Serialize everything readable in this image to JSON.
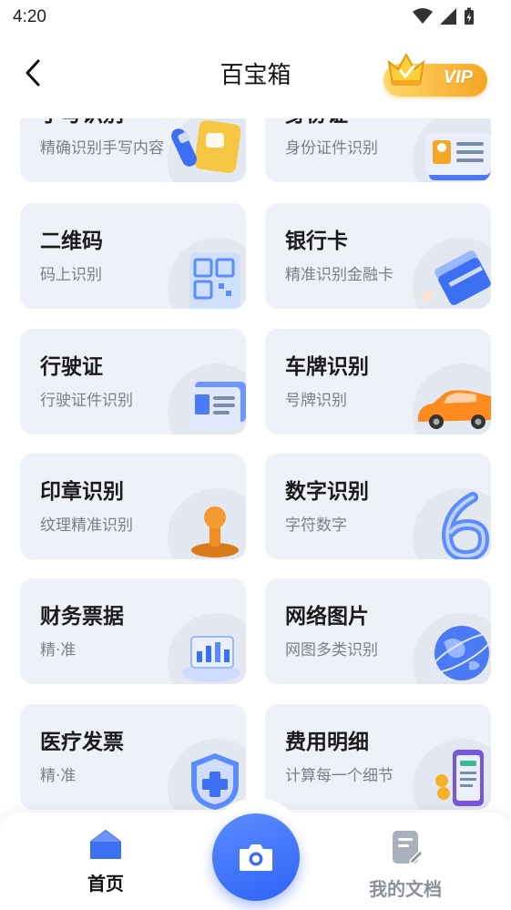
{
  "status_bar": {
    "time": "4:20"
  },
  "header": {
    "title": "百宝箱",
    "vip_label": "VIP",
    "back_icon": "chevron-left-icon"
  },
  "colors": {
    "accent": "#2f63f5",
    "card_bg": "#eef1f7",
    "vip_gold": "#f5a623"
  },
  "cards": [
    {
      "title": "手写识别",
      "subtitle": "精确识别手写内容",
      "icon": "handwriting-icon"
    },
    {
      "title": "身份证",
      "subtitle": "身份证件识别",
      "icon": "id-card-icon"
    },
    {
      "title": "二维码",
      "subtitle": "码上识别",
      "icon": "qr-code-icon"
    },
    {
      "title": "银行卡",
      "subtitle": "精准识别金融卡",
      "icon": "bank-card-icon"
    },
    {
      "title": "行驶证",
      "subtitle": "行驶证件识别",
      "icon": "driving-license-icon"
    },
    {
      "title": "车牌识别",
      "subtitle": "号牌识别",
      "icon": "car-icon"
    },
    {
      "title": "印章识别",
      "subtitle": "纹理精准识别",
      "icon": "stamp-icon"
    },
    {
      "title": "数字识别",
      "subtitle": "字符数字",
      "icon": "number-six-icon"
    },
    {
      "title": "财务票据",
      "subtitle": "精·准",
      "icon": "finance-chart-icon"
    },
    {
      "title": "网络图片",
      "subtitle": "网图多类识别",
      "icon": "globe-icon"
    },
    {
      "title": "医疗发票",
      "subtitle": "精·准",
      "icon": "medical-shield-icon"
    },
    {
      "title": "费用明细",
      "subtitle": "计算每一个细节",
      "icon": "phone-bill-icon"
    }
  ],
  "tabbar": {
    "home_label": "首页",
    "docs_label": "我的文档",
    "camera_icon": "camera-icon"
  }
}
